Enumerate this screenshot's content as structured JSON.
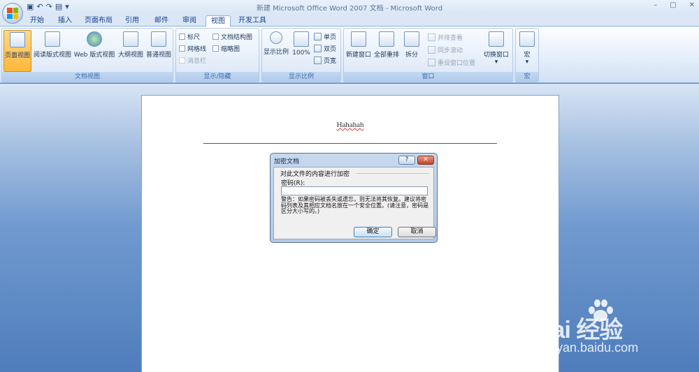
{
  "window": {
    "title": "新建 Microsoft Office Word 2007 文档 - Microsoft Word",
    "minimize": "–",
    "maximize": "□",
    "close": "✕"
  },
  "qat": {
    "save_icon": "save-icon",
    "undo_icon": "undo-icon",
    "redo_icon": "redo-icon",
    "print_preview_icon": "print-preview-icon"
  },
  "tabs": [
    {
      "label": "开始"
    },
    {
      "label": "插入"
    },
    {
      "label": "页面布局"
    },
    {
      "label": "引用"
    },
    {
      "label": "邮件"
    },
    {
      "label": "审阅"
    },
    {
      "label": "视图",
      "active": true
    },
    {
      "label": "开发工具"
    }
  ],
  "ribbon": {
    "doc_views": {
      "label": "文档视图",
      "buttons": [
        "页面视图",
        "阅读版式视图",
        "Web 版式视图",
        "大纲视图",
        "普通视图"
      ]
    },
    "show_hide": {
      "label": "显示/隐藏",
      "items": [
        "标尺",
        "文档结构图",
        "网格线",
        "缩略图",
        "消息栏"
      ]
    },
    "zoom": {
      "label": "显示比例",
      "buttons": [
        "显示比例",
        "100%"
      ],
      "small": [
        "单页",
        "双页",
        "页宽"
      ]
    },
    "window": {
      "label": "窗口",
      "buttons": [
        "新建窗口",
        "全部重排",
        "拆分"
      ],
      "small": [
        "并排查看",
        "同步滚动",
        "重设窗口位置"
      ],
      "switch": "切换窗口"
    },
    "macros": {
      "label": "宏",
      "button": "宏"
    }
  },
  "document": {
    "header_text": "Hahahah"
  },
  "dialog": {
    "title": "加密文档",
    "help": "?",
    "close": "✕",
    "legend": "对此文件的内容进行加密",
    "password_label": "密码(R):",
    "password_value": "",
    "warning": "警告：如果密码被丢失或遗忘，则无法将其恢复。建议将密码列表及其相应文档名放在一个安全位置。(请注意，密码是区分大小写的。)",
    "ok": "确定",
    "cancel": "取消"
  },
  "watermark": {
    "brand": "Bai 经验",
    "url": "jingyan.baidu.com"
  }
}
